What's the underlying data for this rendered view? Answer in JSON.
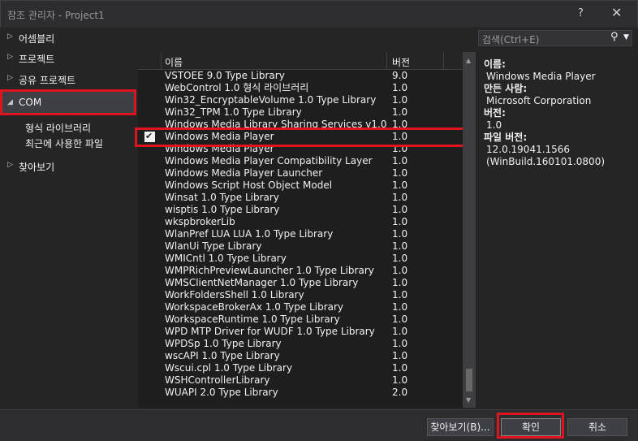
{
  "window": {
    "title": "참조 관리자 - Project1",
    "help": "?",
    "close": "✕"
  },
  "nav": {
    "items": [
      {
        "label": "어셈블리",
        "arrow": "▷"
      },
      {
        "label": "프로젝트",
        "arrow": "▷"
      },
      {
        "label": "공유 프로젝트",
        "arrow": "▷"
      },
      {
        "label": "COM",
        "arrow": "◢"
      },
      {
        "label": "찾아보기",
        "arrow": "▷"
      }
    ],
    "sub": [
      "형식 라이브러리",
      "최근에 사용한 파일"
    ]
  },
  "search": {
    "placeholder": "검색(Ctrl+E)"
  },
  "list": {
    "columns": {
      "name": "이름",
      "version": "버전"
    },
    "rows": [
      {
        "name": "VSTOEE 9.0 Type Library",
        "version": "9.0",
        "checked": false
      },
      {
        "name": "WebControl 1.0 형식 라이브러리",
        "version": "1.0",
        "checked": false
      },
      {
        "name": "Win32_EncryptableVolume 1.0 Type Library",
        "version": "1.0",
        "checked": false
      },
      {
        "name": "Win32_TPM 1.0 Type Library",
        "version": "1.0",
        "checked": false
      },
      {
        "name": "Windows Media Library Sharing Services v1.0",
        "version": "1.0",
        "checked": false
      },
      {
        "name": "Windows Media Player",
        "version": "1.0",
        "checked": true
      },
      {
        "name": "Windows Media Player",
        "version": "1.0",
        "checked": false
      },
      {
        "name": "Windows Media Player Compatibility Layer",
        "version": "1.0",
        "checked": false
      },
      {
        "name": "Windows Media Player Launcher",
        "version": "1.0",
        "checked": false
      },
      {
        "name": "Windows Script Host Object Model",
        "version": "1.0",
        "checked": false
      },
      {
        "name": "Winsat 1.0 Type Library",
        "version": "1.0",
        "checked": false
      },
      {
        "name": "wisptis 1.0 Type Library",
        "version": "1.0",
        "checked": false
      },
      {
        "name": "wkspbrokerLib",
        "version": "1.0",
        "checked": false
      },
      {
        "name": "WlanPref LUA LUA 1.0 Type Library",
        "version": "1.0",
        "checked": false
      },
      {
        "name": "WlanUi Type Library",
        "version": "1.0",
        "checked": false
      },
      {
        "name": "WMICntl 1.0 Type Library",
        "version": "1.0",
        "checked": false
      },
      {
        "name": "WMPRichPreviewLauncher 1.0 Type Library",
        "version": "1.0",
        "checked": false
      },
      {
        "name": "WMSClientNetManager 1.0 Type Library",
        "version": "1.0",
        "checked": false
      },
      {
        "name": "WorkFoldersShell 1.0 Library",
        "version": "1.0",
        "checked": false
      },
      {
        "name": "WorkspaceBrokerAx 1.0 Type Library",
        "version": "1.0",
        "checked": false
      },
      {
        "name": "WorkspaceRuntime 1.0 Type Library",
        "version": "1.0",
        "checked": false
      },
      {
        "name": "WPD MTP Driver for WUDF 1.0 Type Library",
        "version": "1.0",
        "checked": false
      },
      {
        "name": "WPDSp 1.0 Type Library",
        "version": "1.0",
        "checked": false
      },
      {
        "name": "wscAPI 1.0 Type Library",
        "version": "1.0",
        "checked": false
      },
      {
        "name": "Wscui.cpl 1.0 Type Library",
        "version": "1.0",
        "checked": false
      },
      {
        "name": "WSHControllerLibrary",
        "version": "1.0",
        "checked": false
      },
      {
        "name": "WUAPI 2.0 Type Library",
        "version": "2.0",
        "checked": false
      }
    ]
  },
  "details": {
    "name_label": "이름:",
    "name": "Windows Media Player",
    "creator_label": "만든 사람:",
    "creator": "Microsoft Corporation",
    "version_label": "버전:",
    "version": "1.0",
    "file_version_label": "파일 버전:",
    "file_version": "12.0.19041.1566",
    "build": "(WinBuild.160101.0800)"
  },
  "buttons": {
    "browse": "찾아보기(B)...",
    "ok": "확인",
    "cancel": "취소"
  },
  "colors": {
    "highlight": "#e0141e",
    "background": "#252526",
    "list_bg": "#1e1e1e"
  }
}
